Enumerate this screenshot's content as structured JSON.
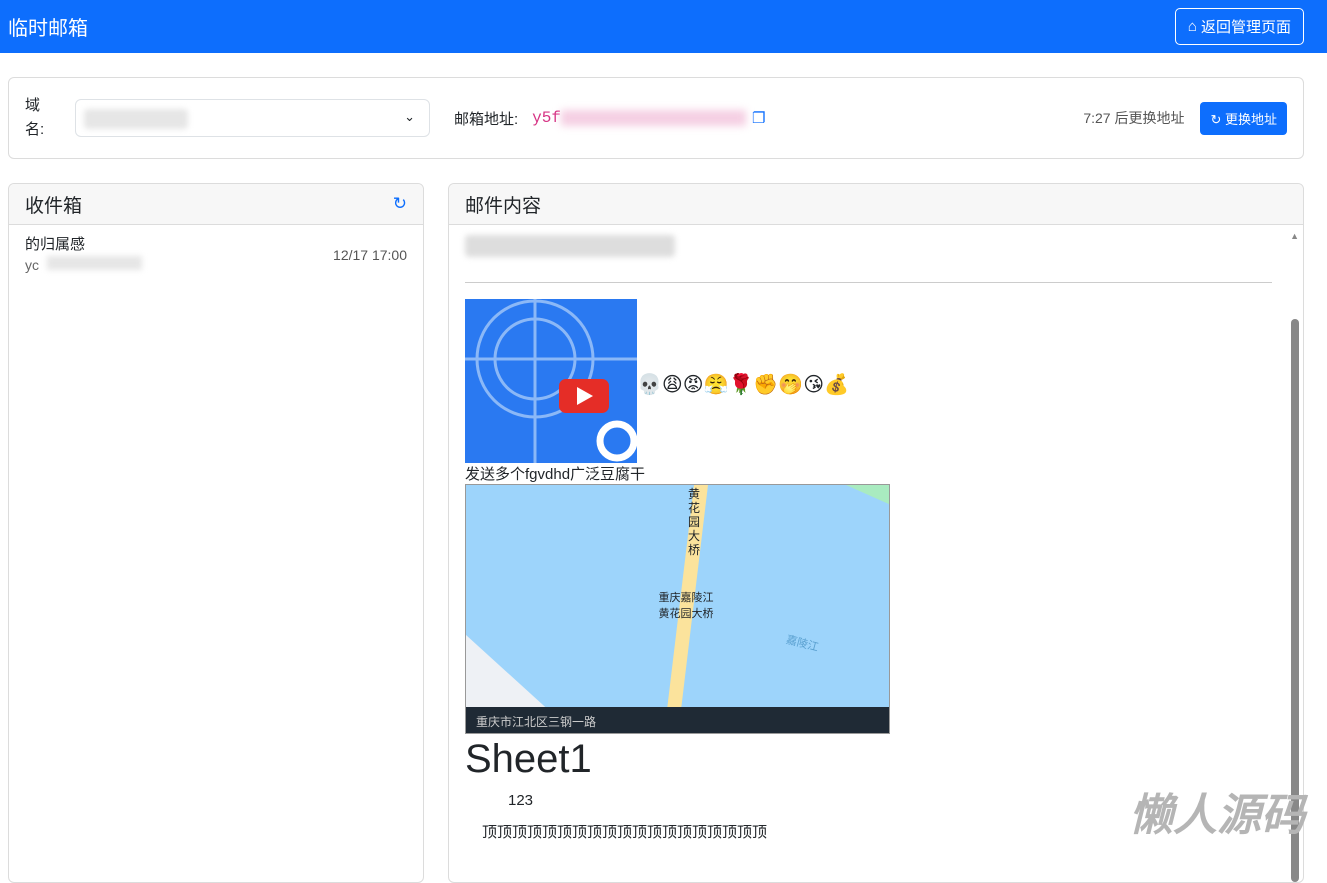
{
  "nav": {
    "title": "临时邮箱",
    "back_label": "返回管理页面"
  },
  "top": {
    "domain_label": "域名:",
    "address_label": "邮箱地址:",
    "address_visible": "y5f",
    "timer": "7:27 后更换地址",
    "change_label": "更换地址"
  },
  "inbox": {
    "title": "收件箱",
    "items": [
      {
        "subject": "的归属感",
        "from": "yc",
        "time": "12/17 17:00"
      }
    ]
  },
  "mail": {
    "title": "邮件内容",
    "emojis": "💀😩😡😤🌹✊🤭😘💰",
    "text1": "发送多个fgvdhd广泛豆腐干",
    "map": {
      "label1": "黄花园大桥",
      "label2": "重庆嘉陵江黄花园大桥",
      "label3": "嘉陵江",
      "caption": "重庆市江北区三钢一路"
    },
    "sheet_title": "Sheet1",
    "cell1": "123",
    "cell2": "顶顶顶顶顶顶顶顶顶顶顶顶顶顶顶顶顶顶顶"
  },
  "watermark": "懒人源码"
}
